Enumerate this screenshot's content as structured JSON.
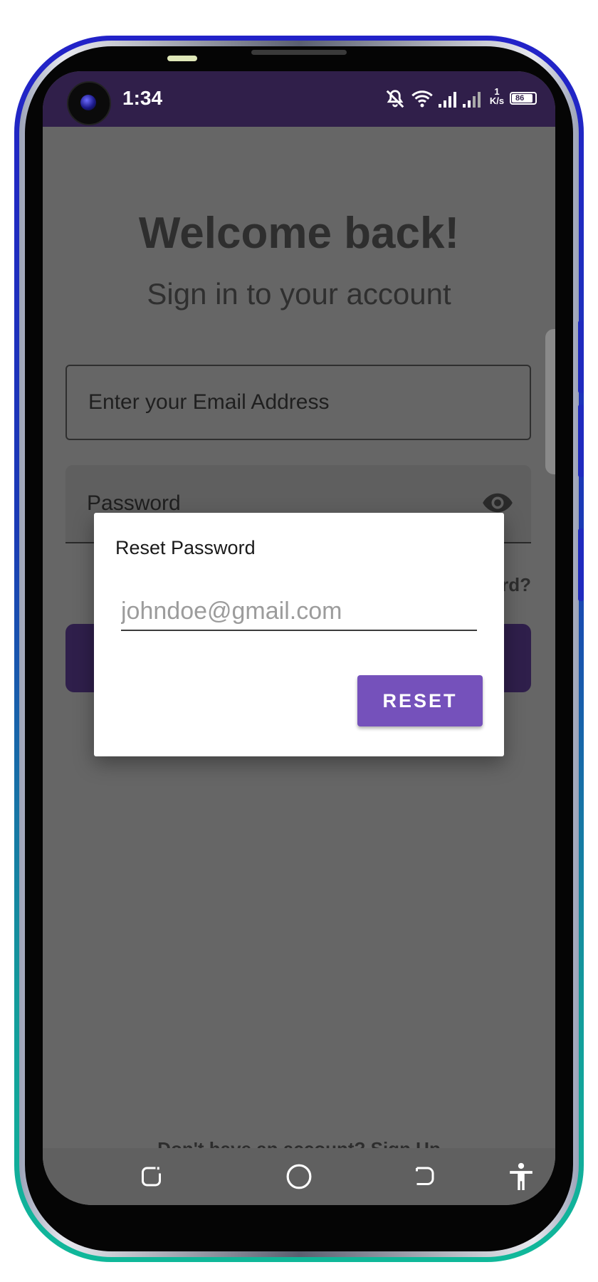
{
  "status_bar": {
    "time": "1:34",
    "network_speed_value": "1",
    "network_speed_unit": "K/s",
    "battery": "86",
    "icons": [
      "camera-icon",
      "bell-off-icon",
      "wifi-icon",
      "signal-icon",
      "signal-icon",
      "battery-icon"
    ]
  },
  "login": {
    "title": "Welcome back!",
    "subtitle": "Sign in to your account",
    "email_placeholder": "Enter your Email Address",
    "password_label": "Password",
    "forgot_password_visible": "rd?",
    "signup_prompt": "Don't have an account? Sign Up"
  },
  "dialog": {
    "title": "Reset Password",
    "input_placeholder": "johndoe@gmail.com",
    "input_value": "",
    "reset_label": "RESET"
  },
  "nav_bar": {
    "icons": [
      "recent-apps-icon",
      "home-icon",
      "back-icon",
      "accessibility-icon"
    ]
  },
  "colors": {
    "status_bar": "#301f4a",
    "scrim_background": "#666666",
    "reset_button": "#7551bb",
    "signin_button": "#2f1f4b"
  }
}
